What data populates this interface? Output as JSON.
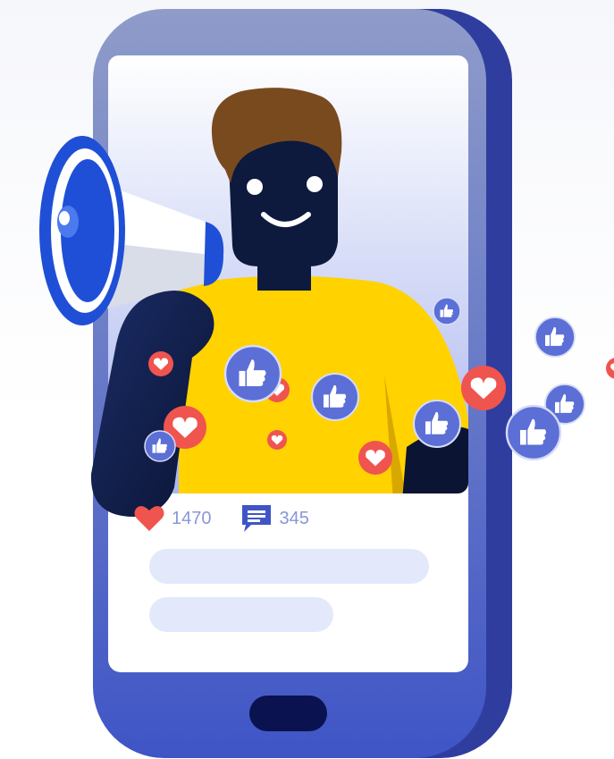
{
  "post": {
    "likes_count": "1470",
    "comments_count": "345"
  },
  "icons": {
    "like": "heart-icon",
    "comment": "comment-icon",
    "thumb": "thumbs-up-icon",
    "megaphone": "megaphone-icon"
  },
  "colors": {
    "phone_body": "#4a5bc9",
    "phone_edge": "#2f3e9e",
    "screen": "#ffffff",
    "heart": "#f0544f",
    "thumb_badge": "#5b6fd6",
    "shirt": "#ffd200",
    "hair": "#7a4a1f",
    "skin": "#0d1a3d",
    "megaphone_blue": "#1f4fd6",
    "placeholder_bar": "#e3e9fb"
  }
}
